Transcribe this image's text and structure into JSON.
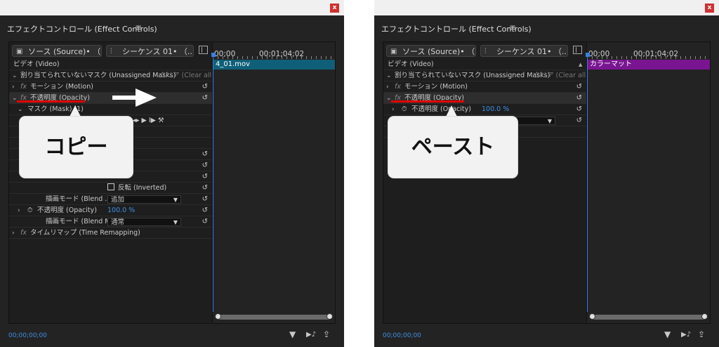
{
  "left": {
    "title": "エフェクトコントロール (Effect Controls)",
    "menu_glyph": "≡",
    "source_tab": "ソース (Source)• （...",
    "sequence_tab": "シーケンス 01• （...",
    "timecode_start": "00;00",
    "timecode_mid": "00;01;04;02",
    "clip_name": "4_01.mov",
    "rows": {
      "video": "ビデオ (Video)",
      "unassigned": "割り当てられていないマスク (Unassigned Masks)",
      "clear": "クリア (Clear all)",
      "motion": "モーション (Motion)",
      "opacity": "不透明度 (Opacity)",
      "mask": "マスク (Mask) (1)",
      "inverted": "反転 (Inverted)",
      "blend1_label": "描画モード (Blend ...",
      "blend1_value": "追加",
      "opacity2_label": "不透明度 (Opacity)",
      "opacity2_value": "100.0 %",
      "blend2_label": "描画モード (Blend Mo...",
      "blend2_value": "通常",
      "time_remap": "タイムリマップ (Time Remapping)"
    },
    "footer_timecode": "00;00;00;00",
    "callout": "コピー"
  },
  "right": {
    "title": "エフェクトコントロール (Effect Controls)",
    "menu_glyph": "≡",
    "source_tab": "ソース (Source)• （...",
    "sequence_tab": "シーケンス 01• （...",
    "timecode_start": "00;00",
    "timecode_mid": "00;01;04;02",
    "clip_name": "カラーマット",
    "rows": {
      "video": "ビデオ (Video)",
      "unassigned": "割り当てられていないマスク (Unassigned Masks)",
      "clear": "クリア (Clear all)",
      "motion": "モーション (Motion)",
      "opacity": "不透明度 (Opacity)",
      "opacity_sub_label": "不透明度 (Opacity)",
      "opacity_sub_value": "100.0 %"
    },
    "footer_timecode": "00;00;00;00",
    "callout": "ペースト"
  },
  "colors": {
    "accent_blue": "#3f8fe6",
    "clip_teal": "#0f5f78",
    "clip_purple": "#7a1592",
    "annotation_red": "#e00000"
  },
  "icons": {
    "close": "x",
    "reset": "↺",
    "filter": "▼",
    "play": "▶"
  }
}
